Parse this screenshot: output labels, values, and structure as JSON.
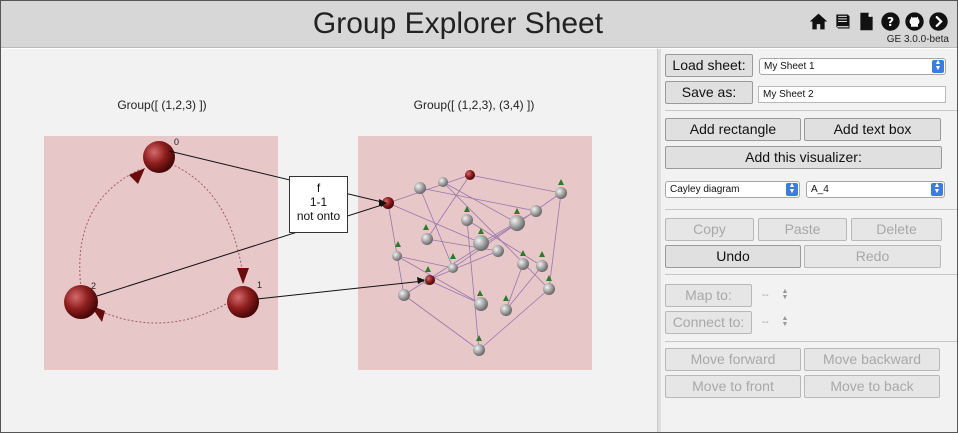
{
  "header": {
    "title": "Group Explorer Sheet",
    "version": "GE 3.0.0-beta"
  },
  "nav": [
    "home-icon",
    "book-icon",
    "document-icon",
    "help-icon",
    "github-icon",
    "next-icon"
  ],
  "sheet": {
    "left_viz": {
      "label": "Group([ (1,2,3) ])",
      "nodes": [
        "0",
        "1",
        "2"
      ]
    },
    "right_viz": {
      "label": "Group([ (1,2,3), (3,4) ])"
    },
    "homomorphism": {
      "name": "f",
      "line1": "1-1",
      "line2": "not onto"
    }
  },
  "panel": {
    "load_sheet_label": "Load sheet:",
    "load_sheet_value": "My Sheet 1",
    "save_as_label": "Save as:",
    "save_as_value": "My Sheet 2",
    "add_rectangle": "Add rectangle",
    "add_text_box": "Add text box",
    "add_visualizer": "Add this visualizer:",
    "visualizer_type": "Cayley diagram",
    "visualizer_group": "A_4",
    "copy": "Copy",
    "paste": "Paste",
    "delete": "Delete",
    "undo": "Undo",
    "redo": "Redo",
    "map_to": "Map to:",
    "map_to_value": "--",
    "connect_to": "Connect to:",
    "connect_to_value": "--",
    "move_forward": "Move forward",
    "move_backward": "Move backward",
    "move_to_front": "Move to front",
    "move_to_back": "Move to back"
  },
  "colors": {
    "viz_background": "#e8c7c9",
    "node": "#8e1e1e",
    "node_grey": "#a0a0a0",
    "select_accent": "#3b7ddd"
  }
}
